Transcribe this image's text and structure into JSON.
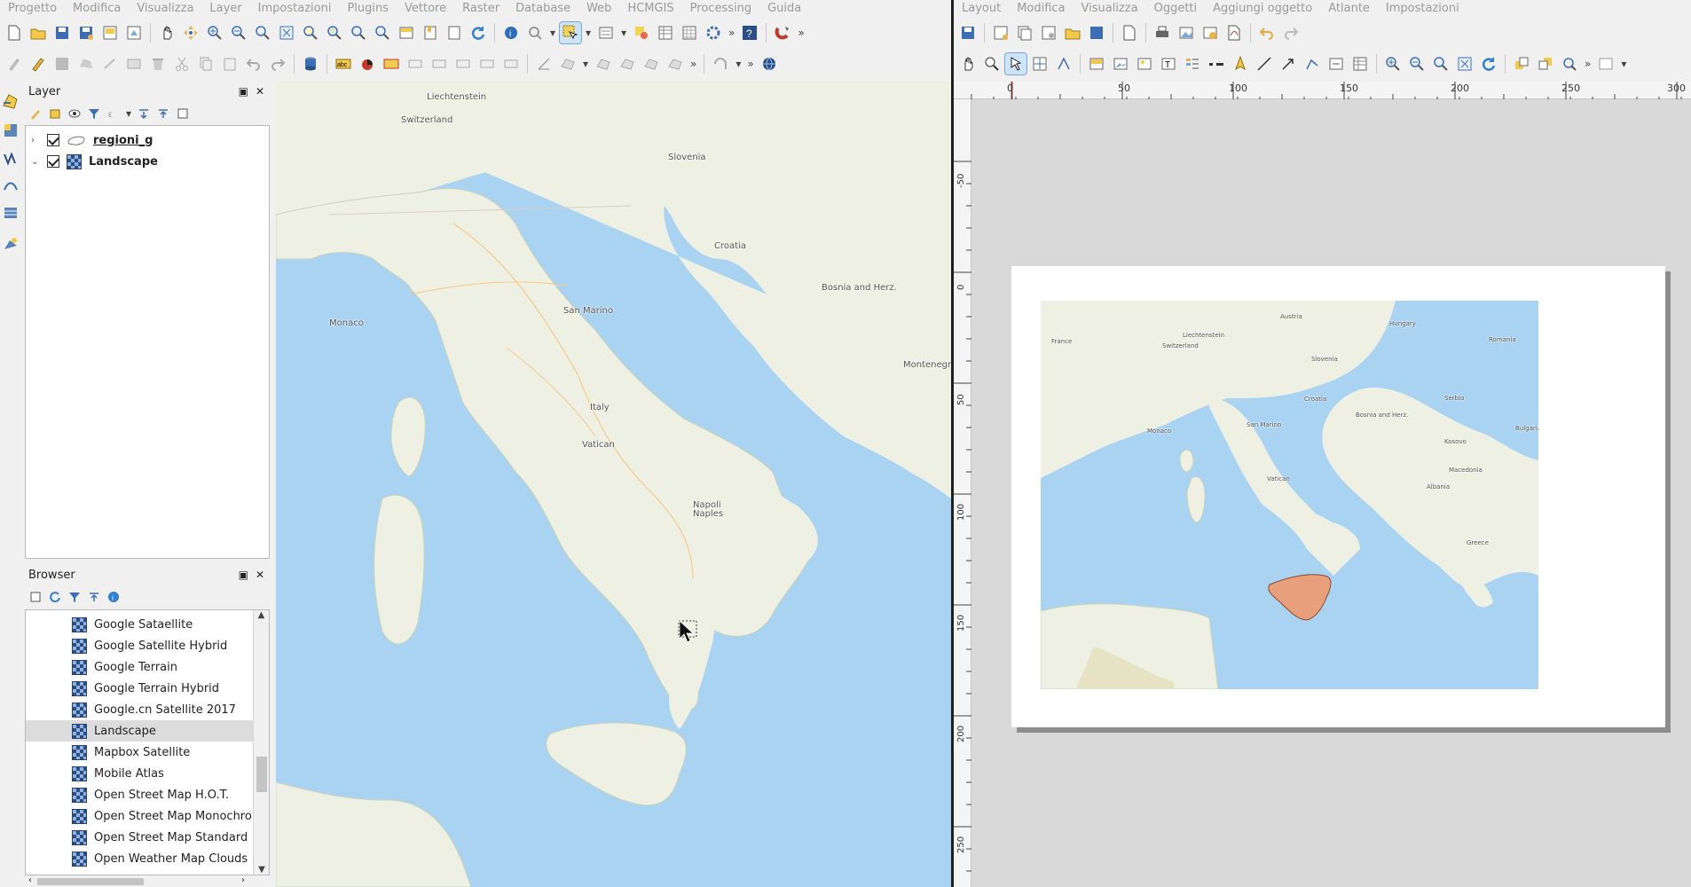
{
  "qgis_menu": [
    "Progetto",
    "Modifica",
    "Visualizza",
    "Layer",
    "Impostazioni",
    "Plugins",
    "Vettore",
    "Raster",
    "Database",
    "Web",
    "HCMGIS",
    "Processing",
    "Guida"
  ],
  "layout_menu": [
    "Layout",
    "Modifica",
    "Visualizza",
    "Oggetti",
    "Aggiungi oggetto",
    "Atlante",
    "Impostazioni"
  ],
  "layers_panel": {
    "title": "Layer",
    "layers": [
      {
        "name": "regioni_g",
        "checked": true,
        "expanded": false,
        "type": "vector"
      },
      {
        "name": "Landscape",
        "checked": true,
        "expanded": true,
        "type": "raster"
      }
    ]
  },
  "browser_panel": {
    "title": "Browser",
    "items": [
      "Google Sataellite",
      "Google Satellite Hybrid",
      "Google Terrain",
      "Google Terrain Hybrid",
      "Google.cn Satellite 2017",
      "Landscape",
      "Mapbox Satellite",
      "Mobile Atlas",
      "Open Street Map H.O.T.",
      "Open Street Map Monochrom",
      "Open Street Map Standard",
      "Open Weather Map Clouds"
    ],
    "selected": "Landscape"
  },
  "map_labels": [
    "Liechtenstein",
    "Switzerland",
    "Slovenia",
    "Croatia",
    "Bosnia and Herz.",
    "Montenegro",
    "Monaco",
    "San Marino",
    "Italy",
    "Vatican",
    "Napoli Naples"
  ],
  "ruler_h": [
    "0",
    "50",
    "100",
    "150",
    "200",
    "250",
    "300"
  ],
  "ruler_v": [
    "-50",
    "0",
    "50",
    "100",
    "150",
    "200",
    "250"
  ],
  "layout_map_labels": [
    "France",
    "Austria",
    "Hungary",
    "Romania",
    "Liechtenstein",
    "Switzerland",
    "Slovenia",
    "Croatia",
    "Serbia",
    "Monaco",
    "San Marino",
    "Bosnia and Herz.",
    "Kosovo",
    "Bulgaria",
    "Vatican",
    "Macedonia",
    "Albania",
    "Greece"
  ],
  "colors": {
    "sea": "#aad3f2",
    "land": "#eef0e4",
    "highlight": "#e8a07c",
    "selection": "#cde3f7"
  }
}
